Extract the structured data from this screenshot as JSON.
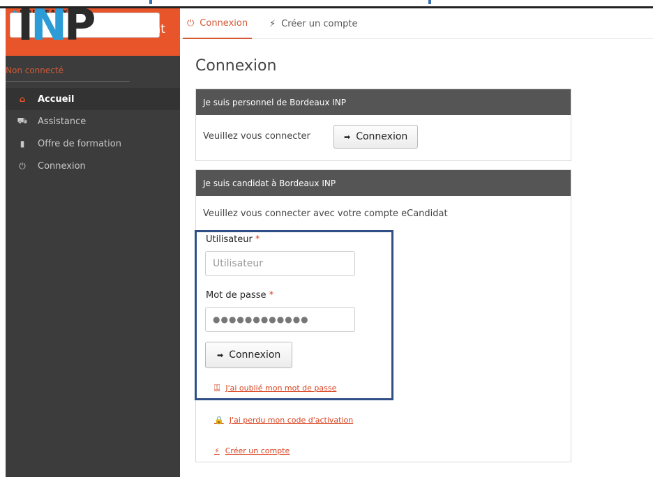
{
  "logo": {
    "top_text": "BORDEAUX",
    "brand_i": "I",
    "brand_n": "N",
    "brand_p": "P",
    "app_name": "eCandidat"
  },
  "sidebar": {
    "status": "Non connecté",
    "items": [
      {
        "label": "Accueil",
        "icon": "home-icon",
        "active": true
      },
      {
        "label": "Assistance",
        "icon": "ambulance-icon",
        "active": false
      },
      {
        "label": "Offre de formation",
        "icon": "bookmark-icon",
        "active": false
      },
      {
        "label": "Connexion",
        "icon": "power-icon",
        "active": false
      }
    ]
  },
  "tabs": [
    {
      "label": "Connexion",
      "icon": "power-icon",
      "active": true
    },
    {
      "label": "Créer un compte",
      "icon": "magic-wand-icon",
      "active": false
    }
  ],
  "page_title": "Connexion",
  "panel_staff": {
    "heading": "Je suis personnel de Bordeaux INP",
    "prompt": "Veuillez vous connecter",
    "button": "Connexion"
  },
  "panel_candidate": {
    "heading": "Je suis candidat à Bordeaux INP",
    "prompt": "Veuillez vous connecter avec votre compte eCandidat",
    "user_label": "Utilisateur",
    "user_placeholder": "Utilisateur",
    "password_label": "Mot de passe",
    "password_value": "●●●●●●●●●●●●",
    "required_mark": "*",
    "button": "Connexion",
    "forgot_password": "J'ai oublié mon mot de passe",
    "lost_code": "J'ai perdu mon code d'activation",
    "create_account": "Créer un compte"
  },
  "colors": {
    "accent": "#e8552b",
    "link": "#d9411e",
    "sidebar_bg": "#3c3c3c",
    "panel_header": "#555555",
    "highlight": "#2f4f86"
  }
}
